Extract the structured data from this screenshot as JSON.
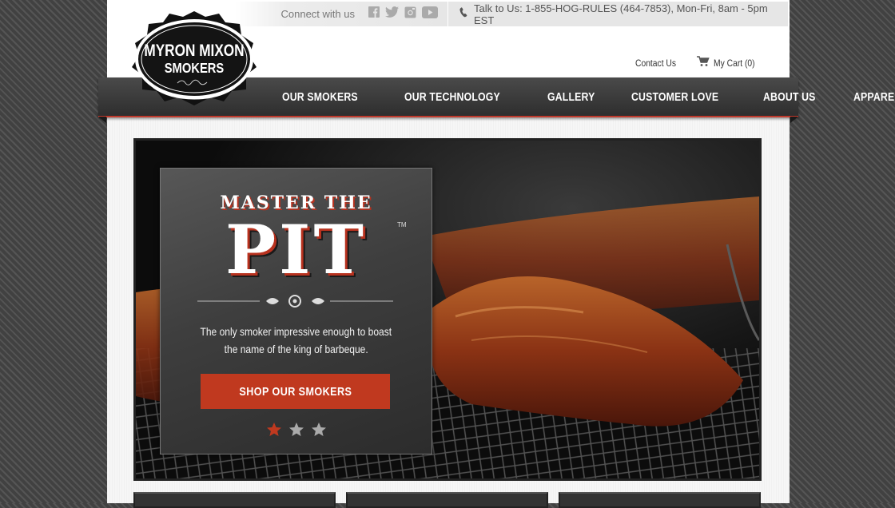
{
  "brand": {
    "name_line1": "MYRON MIXON",
    "name_line2": "SMOKERS"
  },
  "topbar": {
    "connect_label": "Connect with us",
    "social": [
      {
        "name": "facebook-icon"
      },
      {
        "name": "twitter-icon"
      },
      {
        "name": "instagram-icon"
      },
      {
        "name": "youtube-icon"
      }
    ],
    "phone_text": "Talk to Us: 1-855-HOG-RULES (464-7853), Mon-Fri, 8am - 5pm EST"
  },
  "utility": {
    "contact_label": "Contact Us",
    "cart_label": "My Cart (0)"
  },
  "nav": {
    "items": [
      {
        "label": "OUR SMOKERS"
      },
      {
        "label": "OUR TECHNOLOGY"
      },
      {
        "label": "GALLERY"
      },
      {
        "label": "CUSTOMER LOVE"
      },
      {
        "label": "ABOUT US"
      },
      {
        "label": "APPAREL"
      }
    ]
  },
  "hero": {
    "kicker": "MASTER THE",
    "headline": "PIT",
    "trademark": "TM",
    "tagline_line1": "The only smoker impressive enough to boast",
    "tagline_line2": "the name of the king of barbeque.",
    "cta_label": "SHOP OUR SMOKERS",
    "slide_count": 3,
    "active_slide": 1
  },
  "colors": {
    "accent": "#c0391f",
    "nav_bg": "#3a3a3a",
    "page_bg": "#f6f6f6"
  }
}
